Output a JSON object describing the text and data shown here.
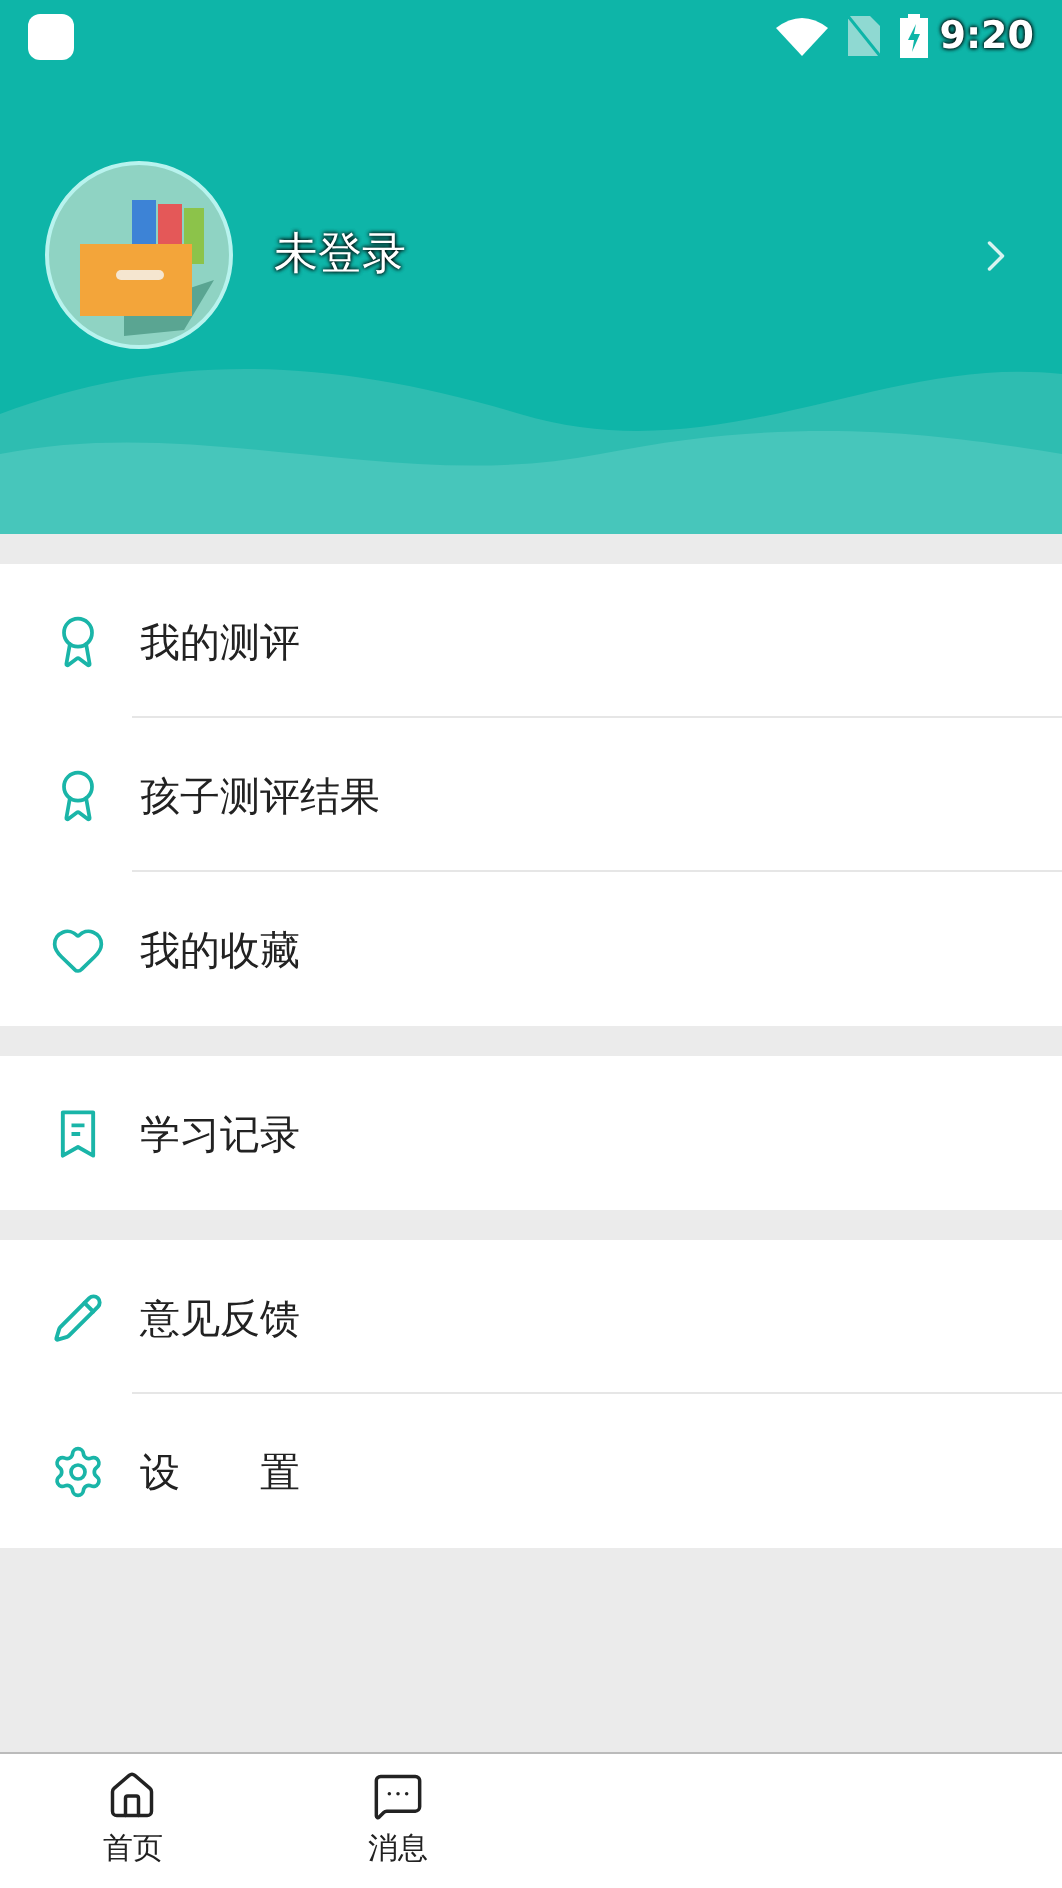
{
  "status_bar": {
    "time": "9:20"
  },
  "profile": {
    "name": "未登录"
  },
  "menu_groups": [
    {
      "items": [
        {
          "label": "我的测评",
          "kind": "medal"
        },
        {
          "label": "孩子测评结果",
          "kind": "medal"
        },
        {
          "label": "我的收藏",
          "kind": "heart"
        }
      ]
    },
    {
      "items": [
        {
          "label": "学习记录",
          "kind": "bookmark"
        }
      ]
    },
    {
      "items": [
        {
          "label": "意见反馈",
          "kind": "pencil"
        },
        {
          "label": "设　　置",
          "kind": "gear"
        }
      ]
    }
  ],
  "bottom_nav": [
    {
      "label": "首页",
      "kind": "home"
    },
    {
      "label": "消息",
      "kind": "message"
    }
  ]
}
